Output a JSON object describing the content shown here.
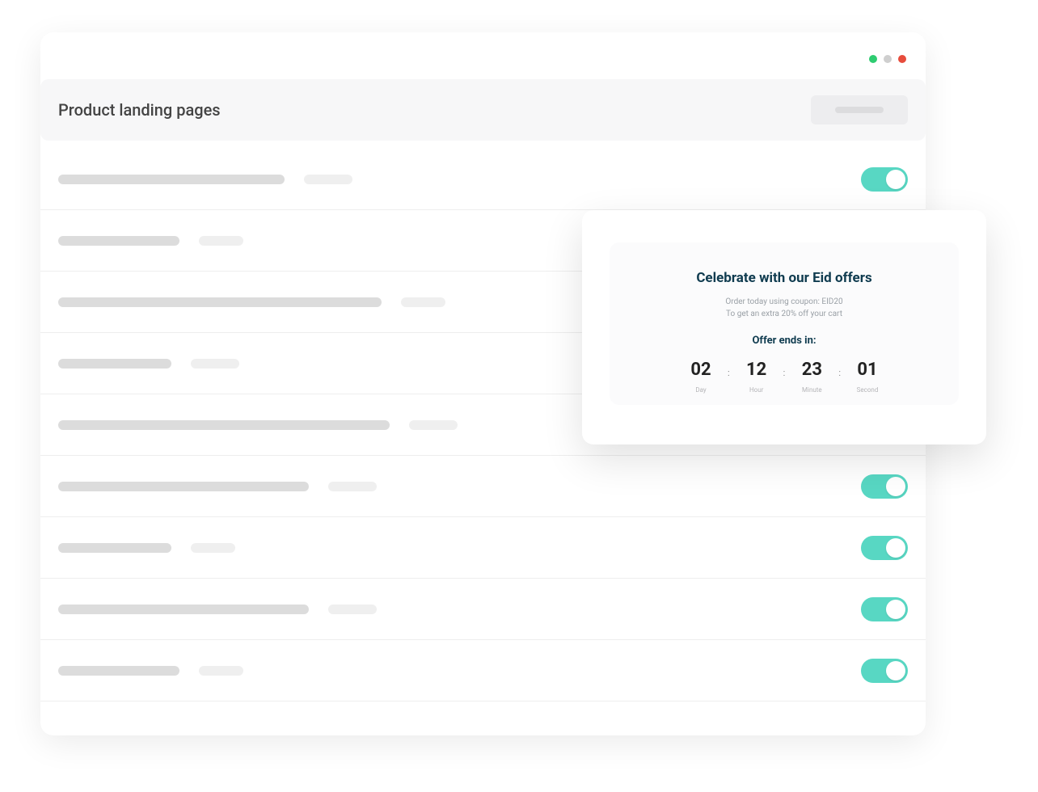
{
  "window": {
    "title": "Product landing pages"
  },
  "rows": [
    {
      "w1": 280,
      "w2": 60,
      "toggle": true
    },
    {
      "w1": 150,
      "w2": 55,
      "toggle": false
    },
    {
      "w1": 400,
      "w2": 55,
      "toggle": false
    },
    {
      "w1": 140,
      "w2": 60,
      "toggle": false
    },
    {
      "w1": 410,
      "w2": 60,
      "toggle": false
    },
    {
      "w1": 310,
      "w2": 60,
      "toggle": true
    },
    {
      "w1": 140,
      "w2": 55,
      "toggle": true
    },
    {
      "w1": 310,
      "w2": 60,
      "toggle": true
    },
    {
      "w1": 150,
      "w2": 55,
      "toggle": true
    }
  ],
  "preview": {
    "title": "Celebrate with our Eid offers",
    "line1": "Order today using coupon: EID20",
    "line2": "To get an extra 20% off your cart",
    "ends_label": "Offer ends in:",
    "countdown": {
      "day": {
        "value": "02",
        "label": "Day"
      },
      "hour": {
        "value": "12",
        "label": "Hour"
      },
      "minute": {
        "value": "23",
        "label": "Minute"
      },
      "second": {
        "value": "01",
        "label": "Second"
      }
    }
  }
}
